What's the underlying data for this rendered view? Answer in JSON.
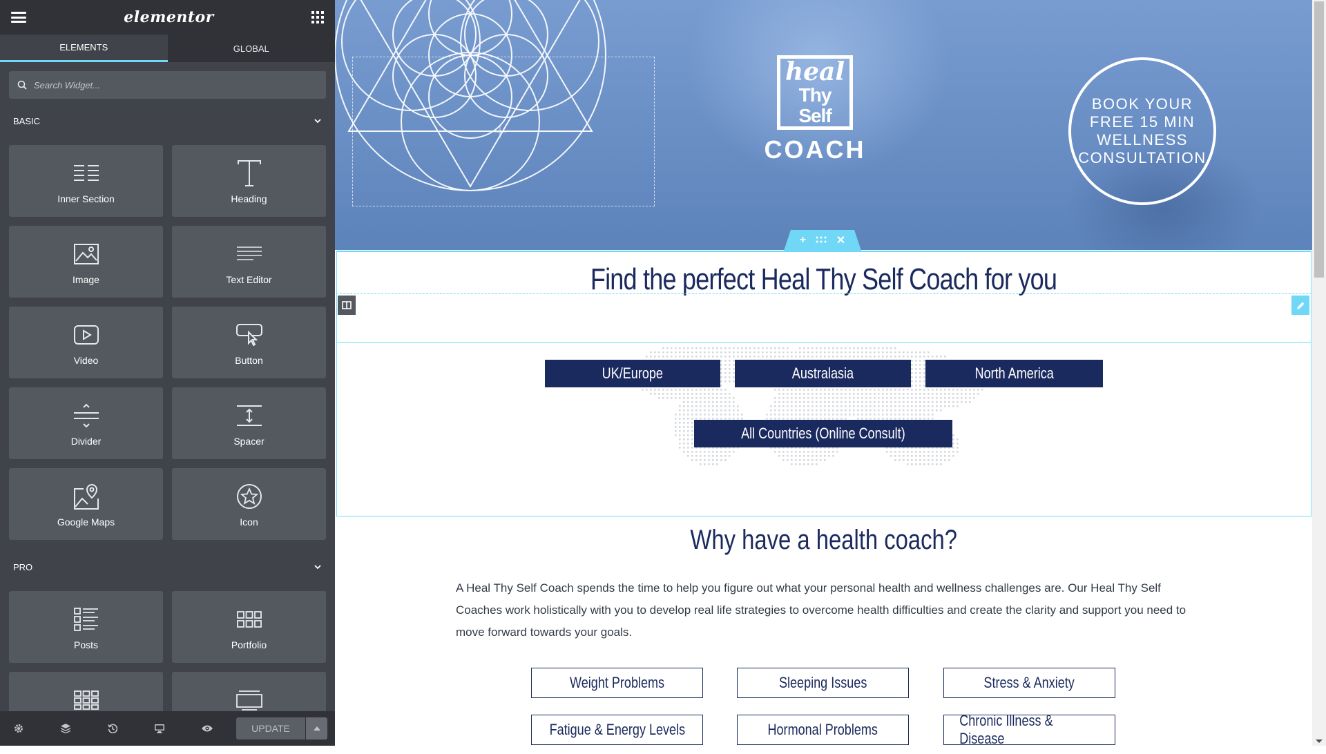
{
  "panel": {
    "logo": "elementor",
    "tabs": [
      {
        "label": "ELEMENTS",
        "active": true
      },
      {
        "label": "GLOBAL",
        "active": false
      }
    ],
    "search": {
      "placeholder": "Search Widget..."
    },
    "categories": [
      {
        "label": "BASIC"
      },
      {
        "label": "PRO"
      }
    ],
    "basic_widgets": [
      {
        "label": "Inner Section",
        "icon": "inner-section-icon"
      },
      {
        "label": "Heading",
        "icon": "heading-icon"
      },
      {
        "label": "Image",
        "icon": "image-icon"
      },
      {
        "label": "Text Editor",
        "icon": "text-editor-icon"
      },
      {
        "label": "Video",
        "icon": "video-icon"
      },
      {
        "label": "Button",
        "icon": "button-icon"
      },
      {
        "label": "Divider",
        "icon": "divider-icon"
      },
      {
        "label": "Spacer",
        "icon": "spacer-icon"
      },
      {
        "label": "Google Maps",
        "icon": "google-maps-icon"
      },
      {
        "label": "Icon",
        "icon": "star-icon"
      }
    ],
    "pro_widgets": [
      {
        "label": "Posts",
        "icon": "posts-icon"
      },
      {
        "label": "Portfolio",
        "icon": "portfolio-icon"
      },
      {
        "label": "",
        "icon": "gallery-icon"
      },
      {
        "label": "",
        "icon": "slides-icon"
      }
    ],
    "footer": {
      "icons": [
        "settings-icon",
        "navigator-icon",
        "history-icon",
        "responsive-icon",
        "preview-icon"
      ],
      "update_label": "UPDATE"
    }
  },
  "preview": {
    "hero": {
      "logo_line1": "heal",
      "logo_line2": "Thy Self",
      "logo_line3": "COACH",
      "cta": "BOOK YOUR FREE 15 MIN WELLNESS CONSULTATION"
    },
    "headline": "Find the perfect Heal Thy Self Coach for you",
    "regions": [
      "UK/Europe",
      "Australasia",
      "North America",
      "All Countries (Online Consult)"
    ],
    "why_title": "Why have a health coach?",
    "why_text": "A Heal Thy Self Coach spends the time to help you figure out what your personal health and wellness challenges are. Our Heal Thy Self Coaches work holistically with you to develop real life strategies to overcome health difficulties and create the clarity and support you need to move forward towards your goals.",
    "topics": [
      "Weight Problems",
      "Sleeping Issues",
      "Stress & Anxiety",
      "Fatigue & Energy Levels",
      "Hormonal Problems",
      "Chronic Illness & Disease"
    ]
  },
  "colors": {
    "panel_bg": "#404349",
    "panel_header": "#303237",
    "accent": "#71d7f7",
    "navy": "#1b2a5e",
    "hero_blue": "#6a8fc4"
  }
}
